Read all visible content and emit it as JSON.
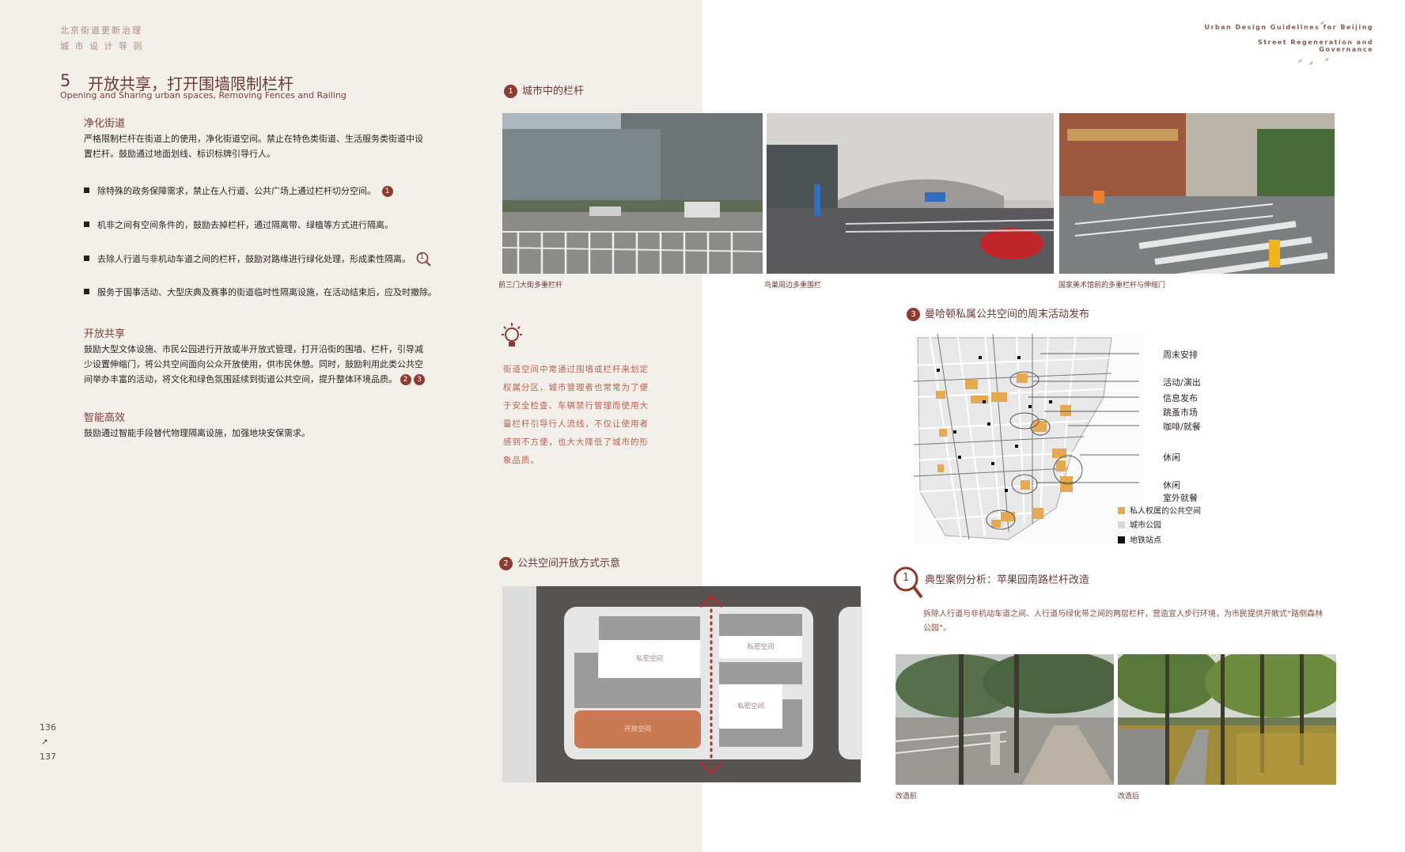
{
  "header": {
    "cn_line1": "北京街道更新治理",
    "cn_line2": "城 市 设 计 导 则",
    "en_line1": "Urban Design Guidelines for Beijing",
    "en_line2": "Street Regeneration and Governance"
  },
  "section": {
    "number": "5",
    "title": "开放共享，打开围墙限制栏杆",
    "subtitle_en": "Opening and Sharing urban spaces, Removing Fences and Railing"
  },
  "blocks": {
    "purify": {
      "heading": "净化街道",
      "para_l1": "严格限制栏杆在街道上的使用，净化街道空间。禁止在特色类街道、生活服务类街道中设",
      "para_l2": "置栏杆。鼓励通过地面划线、标识标牌引导行人。",
      "bullets": [
        "除特殊的政务保障需求，禁止在人行道、公共广场上通过栏杆切分空间。",
        "机非之间有空间条件的，鼓励去掉栏杆，通过隔离带、绿植等方式进行隔离。",
        "去除人行道与非机动车道之间的栏杆，鼓励对路缘进行绿化处理，形成柔性隔离。",
        "服务于国事活动、大型庆典及赛事的街道临时性隔离设施，在活动结束后，应及时撤除。"
      ],
      "bullet1_badge": "1",
      "bullet3_badge": "1"
    },
    "open": {
      "heading": "开放共享",
      "para_l1": "鼓励大型文体设施、市民公园进行开放或半开放式管理，打开沿街的围墙、栏杆，引导减",
      "para_l2": "少设置伸缩门，将公共空间面向公众开放使用，供市民休憩。同时，鼓励利用此类公共空",
      "para_l3": "间举办丰富的活动，将文化和绿色氛围延续到街道公共空间，提升整体环境品质。",
      "badge_a": "2",
      "badge_b": "3"
    },
    "smart": {
      "heading": "智能高效",
      "para": "鼓励通过智能手段替代物理隔离设施，加强地块安保需求。"
    }
  },
  "pages": {
    "left": "136",
    "arrow": "➚",
    "right": "137"
  },
  "tip": {
    "lines": [
      "街道空间中常通过围墙或栏杆来划定",
      "权属分区，城市管理者也常常为了便",
      "于安全检查、车辆禁行管理而使用大",
      "量栏杆引导行人流线，不仅让使用者",
      "感到不方便，也大大降低了城市的形",
      "象品质。"
    ]
  },
  "fig1": {
    "badge": "1",
    "title": "城市中的栏杆",
    "captions": [
      "前三门大街多重栏杆",
      "鸟巢周边多重围栏",
      "国家美术馆前的多重栏杆与伸缩门"
    ]
  },
  "fig2": {
    "badge": "2",
    "title": "公共空间开放方式示意",
    "private_label": "私密空间",
    "open_label": "开放空间"
  },
  "fig3": {
    "badge": "3",
    "title": "曼哈顿私属公共空间的周末活动发布",
    "labels": [
      "周末安排",
      "活动/演出",
      "信息发布",
      "跳蚤市场",
      "咖啡/就餐",
      "休闲",
      "休闲",
      "室外就餐"
    ],
    "legend": [
      "私人权属的公共空间",
      "城市公园",
      "地铁站点"
    ],
    "colors": {
      "private": "#e7a94f",
      "park": "#d9d9d9",
      "metro": "#111111"
    }
  },
  "case": {
    "badge": "1",
    "title": "典型案例分析：苹果园南路栏杆改造",
    "text_l1": "拆除人行道与非机动车道之间、人行道与绿化带之间的两层栏杆，营造宜人步行环境，为市民提供开敞式“路侧森林",
    "text_l2": "公园”。",
    "before": "改造前",
    "after": "改造后"
  }
}
